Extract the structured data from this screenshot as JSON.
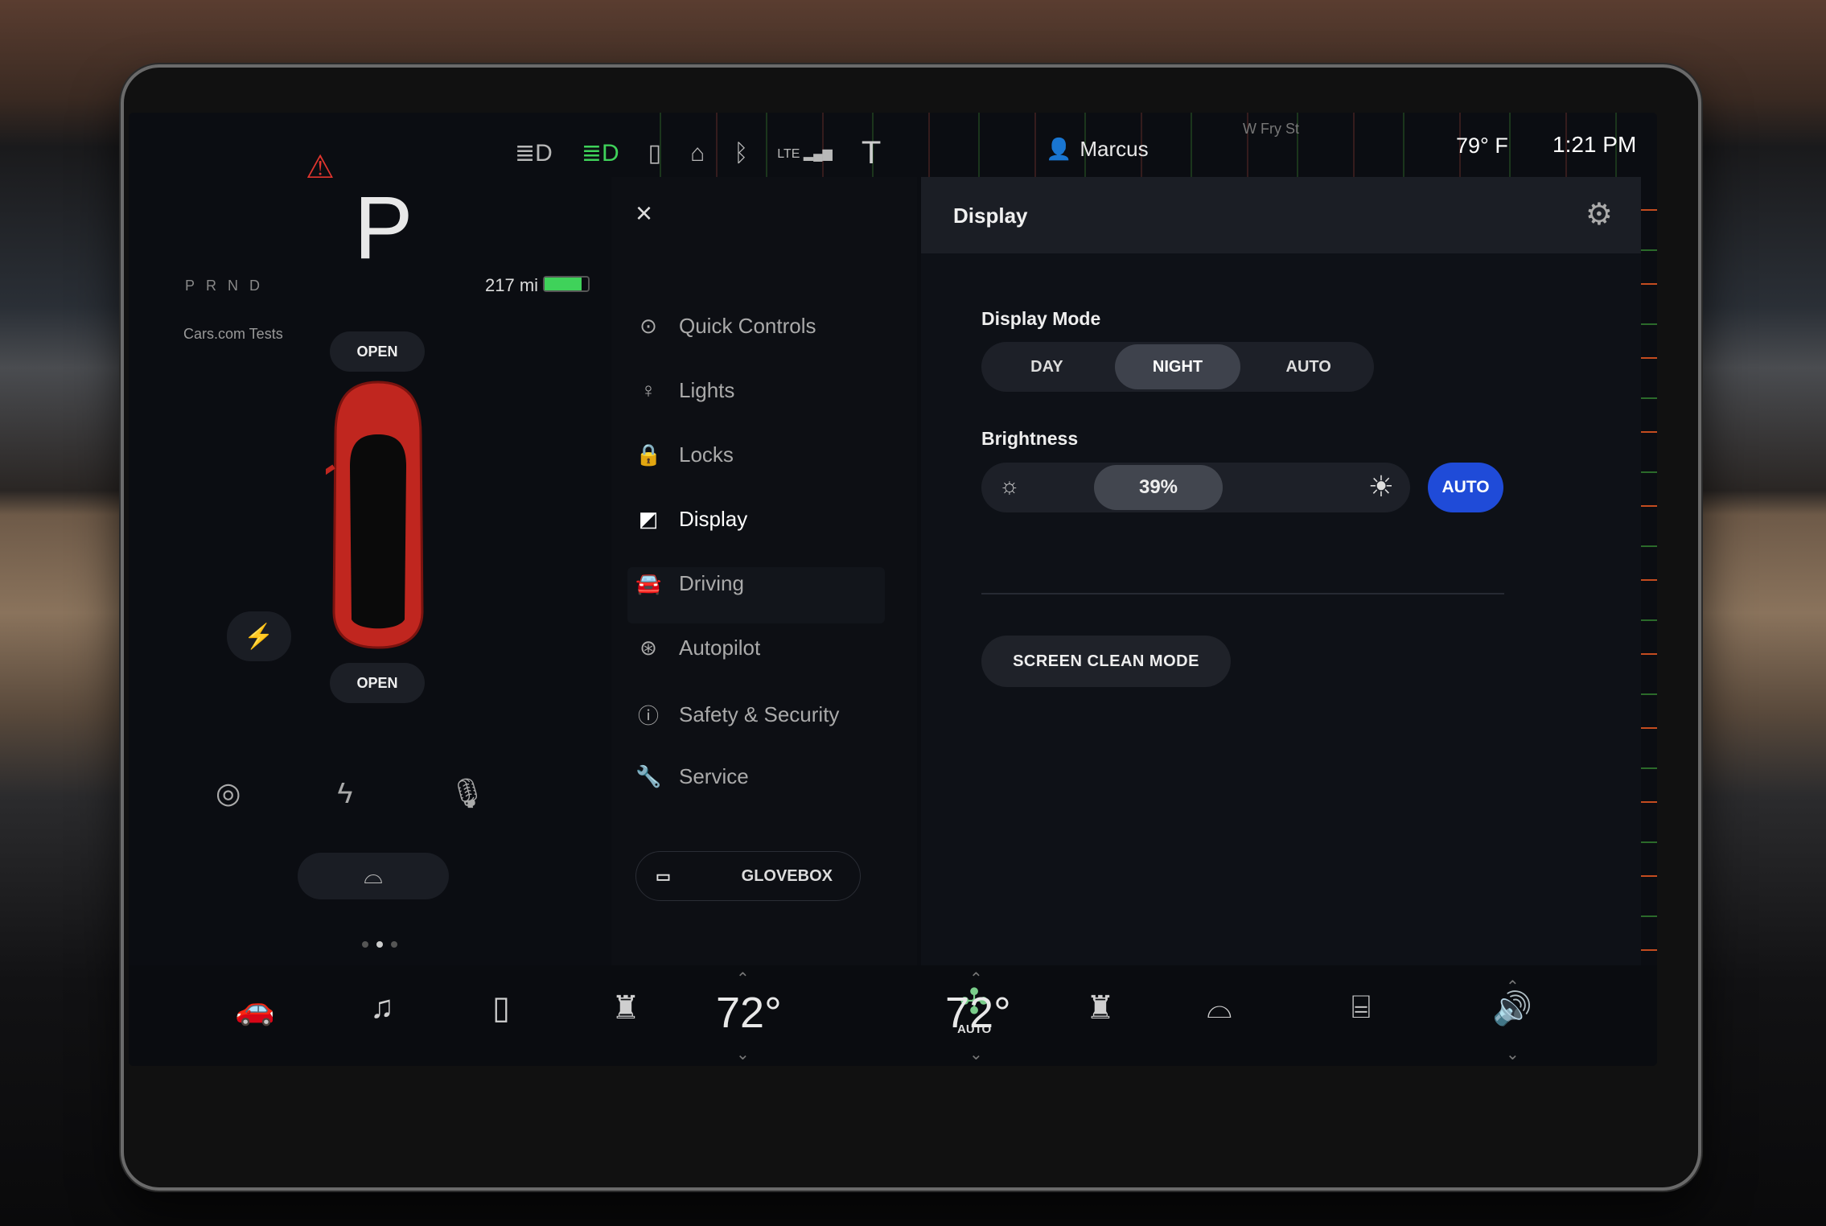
{
  "status": {
    "street": "W Fry St",
    "user": "Marcus",
    "outside_temp": "79° F",
    "time": "1:21 PM",
    "signal": "LTE"
  },
  "vehicle": {
    "gear": "P",
    "prnd": "PRND",
    "range": "217 mi",
    "battery_level": 0.85,
    "car_name": "Cars.com Tests",
    "frunk_label": "OPEN",
    "trunk_label": "OPEN"
  },
  "menu": {
    "items": [
      {
        "label": "Quick Controls",
        "icon": "toggle-icon"
      },
      {
        "label": "Lights",
        "icon": "bulb-icon"
      },
      {
        "label": "Locks",
        "icon": "lock-icon"
      },
      {
        "label": "Display",
        "icon": "display-icon"
      },
      {
        "label": "Driving",
        "icon": "car-icon"
      },
      {
        "label": "Autopilot",
        "icon": "steering-wheel-icon"
      },
      {
        "label": "Safety & Security",
        "icon": "alert-icon"
      },
      {
        "label": "Service",
        "icon": "wrench-icon"
      }
    ],
    "active": "Display",
    "glovebox_label": "GLOVEBOX"
  },
  "display": {
    "title": "Display",
    "mode_label": "Display Mode",
    "modes": [
      "DAY",
      "NIGHT",
      "AUTO"
    ],
    "selected_mode": "NIGHT",
    "brightness_label": "Brightness",
    "brightness_value": "39%",
    "brightness_level": 0.39,
    "auto_label": "AUTO",
    "clean_mode_label": "SCREEN CLEAN MODE"
  },
  "climate": {
    "driver_temp": "72°",
    "passenger_temp": "72°",
    "fan_label": "AUTO"
  },
  "colors": {
    "accent": "#1f4bd8",
    "battery": "#3fd25a",
    "car": "#c0261f"
  }
}
